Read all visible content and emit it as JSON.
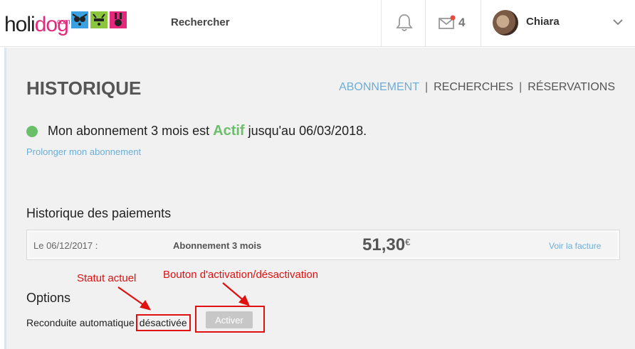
{
  "header": {
    "logo_text_1": "holi",
    "logo_text_2": "dog",
    "logo_com": "com",
    "search_label": "Rechercher",
    "messages_count": "4",
    "user_name": "Chiara"
  },
  "page": {
    "title": "HISTORIQUE",
    "tabs": [
      {
        "label": "ABONNEMENT",
        "active": true
      },
      {
        "label": "RECHERCHES",
        "active": false
      },
      {
        "label": "RÉSERVATIONS",
        "active": false
      }
    ],
    "tab_separator": "|"
  },
  "subscription": {
    "text_before": "Mon abonnement 3 mois est",
    "status": "Actif",
    "text_after": "jusqu'au 06/03/2018.",
    "extend_link": "Prolonger mon abonnement",
    "status_color": "#6bbf6a"
  },
  "payments": {
    "title": "Historique des paiements",
    "rows": [
      {
        "date": "Le 06/12/2017 :",
        "label": "Abonnement 3 mois",
        "amount": "51,30",
        "currency": "€",
        "invoice_link": "Voir la facture"
      }
    ]
  },
  "options": {
    "title": "Options",
    "renew_label": "Reconduite automatique",
    "renew_status": "désactivée",
    "button_label": "Activer"
  },
  "annotations": {
    "status_note": "Statut actuel",
    "button_note": "Bouton d'activation/désactivation",
    "color": "#e01010"
  },
  "colors": {
    "link": "#6eaed6",
    "brand_pink": "#e4287c"
  }
}
